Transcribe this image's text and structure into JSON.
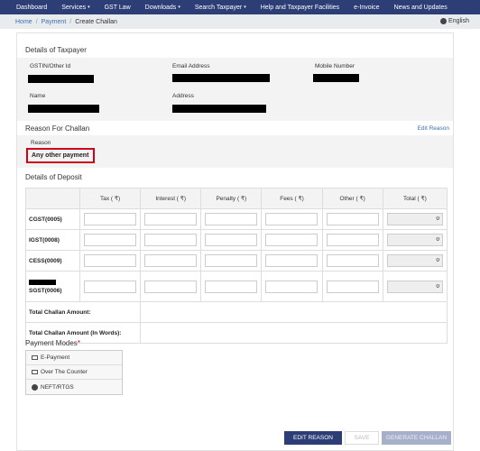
{
  "nav": {
    "items": [
      {
        "label": "Dashboard",
        "caret": false
      },
      {
        "label": "Services",
        "caret": true
      },
      {
        "label": "GST Law",
        "caret": false
      },
      {
        "label": "Downloads",
        "caret": true
      },
      {
        "label": "Search Taxpayer",
        "caret": true
      },
      {
        "label": "Help and Taxpayer Facilities",
        "caret": false
      },
      {
        "label": "e-Invoice",
        "caret": false
      },
      {
        "label": "News and Updates",
        "caret": false
      }
    ],
    "caret": "▾"
  },
  "breadcrumb": {
    "home": "Home",
    "payment": "Payment",
    "current": "Create Challan",
    "sep": "/"
  },
  "language": "English",
  "taxpayer": {
    "title": "Details of Taxpayer",
    "gstin_label": "GSTIN/Other Id",
    "email_label": "Email Address",
    "mobile_label": "Mobile Number",
    "name_label": "Name",
    "address_label": "Address"
  },
  "reason": {
    "title": "Reason For Challan",
    "edit_link": "Edit Reason",
    "label": "Reason",
    "value": "Any other payment"
  },
  "deposit": {
    "title": "Details of Deposit",
    "columns": [
      "",
      "Tax ( ₹)",
      "Interest ( ₹)",
      "Penalty ( ₹)",
      "Fees ( ₹)",
      "Other ( ₹)",
      "Total ( ₹)"
    ],
    "rows": [
      {
        "label": "CGST(0005)",
        "total": "0"
      },
      {
        "label": "IGST(0008)",
        "total": "0"
      },
      {
        "label": "CESS(0009)",
        "total": "0"
      },
      {
        "label": "SGST(0006)",
        "total": "0"
      }
    ],
    "total_amount_label": "Total Challan Amount:",
    "total_words_label": "Total Challan Amount (In Words):"
  },
  "payment_modes": {
    "title": "Payment Modes",
    "required_mark": "*",
    "items": [
      "E-Payment",
      "Over The Counter",
      "NEFT/RTGS"
    ]
  },
  "buttons": {
    "edit_reason": "EDIT REASON",
    "save": "SAVE",
    "generate": "GENERATE CHALLAN"
  }
}
